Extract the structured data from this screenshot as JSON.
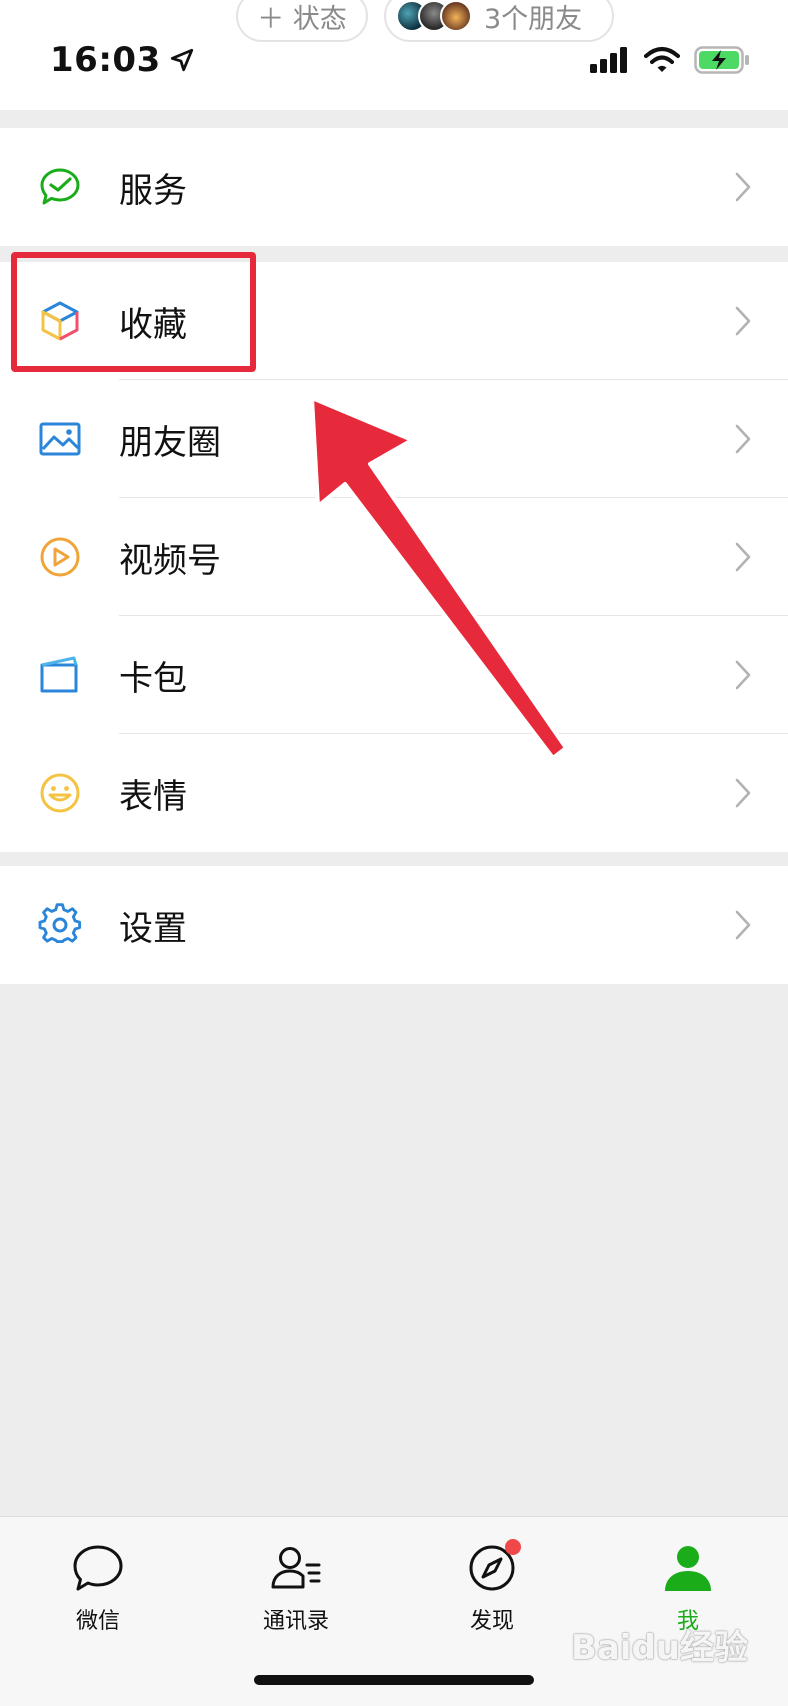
{
  "status_bar": {
    "time": "16:03",
    "status_pill": "＋ 状态",
    "friends_pill": "3个朋友"
  },
  "menu": {
    "group1": [
      {
        "label": "服务",
        "icon": "service-check-icon",
        "color": "#1aad19"
      }
    ],
    "group2": [
      {
        "label": "收藏",
        "icon": "favorites-cube-icon",
        "color": "#f5c342"
      },
      {
        "label": "朋友圈",
        "icon": "moments-picture-icon",
        "color": "#2b86d9"
      },
      {
        "label": "视频号",
        "icon": "channels-play-icon",
        "color": "#f0a53a"
      },
      {
        "label": "卡包",
        "icon": "card-wallet-icon",
        "color": "#2b86d9"
      },
      {
        "label": "表情",
        "icon": "sticker-smile-icon",
        "color": "#f5c342"
      }
    ],
    "group3": [
      {
        "label": "设置",
        "icon": "settings-gear-icon",
        "color": "#2b86d9"
      }
    ]
  },
  "tabbar": {
    "tabs": [
      {
        "label": "微信",
        "icon": "chat-bubble-icon",
        "active": false
      },
      {
        "label": "通讯录",
        "icon": "contacts-icon",
        "active": false
      },
      {
        "label": "发现",
        "icon": "discover-compass-icon",
        "active": false,
        "badge": true
      },
      {
        "label": "我",
        "icon": "me-person-icon",
        "active": true
      }
    ],
    "active_color": "#1aad19"
  },
  "annotation": {
    "highlight_color": "#e62a3c"
  },
  "watermark": "Baidu经验"
}
